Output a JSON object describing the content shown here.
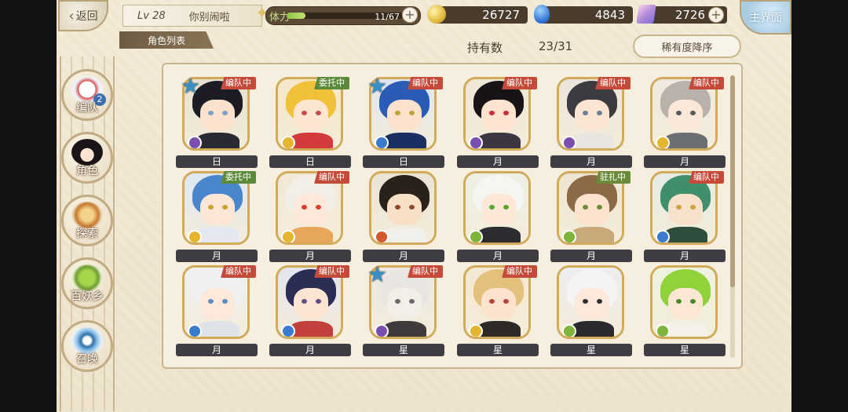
{
  "header": {
    "back_label": "返回",
    "level": "Lv 28",
    "player_name": "你别闹啦",
    "tab_label": "角色列表",
    "stamina_label": "体力",
    "stamina_value": "11/67",
    "stamina_fraction": 0.164,
    "gold": "26727",
    "blue_currency": "4843",
    "crystal": "2726",
    "main_label": "主界面"
  },
  "roster": {
    "count_label": "持有数",
    "count_value": "23/31",
    "sort_label": "稀有度降序"
  },
  "sidebar": {
    "items": [
      {
        "label": "编队",
        "badge": "2"
      },
      {
        "label": "角色"
      },
      {
        "label": "探索"
      },
      {
        "label": "百妖乡"
      },
      {
        "label": "召唤"
      }
    ]
  },
  "cards": [
    {
      "rank": "日",
      "tag": "编队中",
      "tag_type": "team",
      "star": true,
      "hair": "#1c1c24",
      "skin": "#fbe2cd",
      "eye": "#7aa2c8",
      "cloth": "#2a2a33",
      "elem": "#7a4fb0",
      "bg": "#e8e0cf"
    },
    {
      "rank": "日",
      "tag": "委托中",
      "tag_type": "commission",
      "star": false,
      "hair": "#f1c13a",
      "skin": "#fde6d1",
      "eye": "#c94c4c",
      "cloth": "#d33b3b",
      "elem": "#e6b52e",
      "bg": "#f5e7c8"
    },
    {
      "rank": "日",
      "tag": "编队中",
      "tag_type": "team",
      "star": true,
      "hair": "#2a5bb6",
      "skin": "#fbe2cd",
      "eye": "#c0a23a",
      "cloth": "#1b2f63",
      "elem": "#3a7bd0",
      "bg": "#dfe6f2"
    },
    {
      "rank": "月",
      "tag": "编队中",
      "tag_type": "team",
      "star": false,
      "hair": "#171317",
      "skin": "#fde3d0",
      "eye": "#c72f3a",
      "cloth": "#3b3640",
      "elem": "#7a4fb0",
      "bg": "#efe6d6"
    },
    {
      "rank": "月",
      "tag": "编队中",
      "tag_type": "team",
      "star": false,
      "hair": "#3b3b40",
      "skin": "#fbe4d2",
      "eye": "#6e7f95",
      "cloth": "#e9e6e2",
      "elem": "#7a4fb0",
      "bg": "#ebe5dc"
    },
    {
      "rank": "月",
      "tag": "编队中",
      "tag_type": "team",
      "star": false,
      "hair": "#b9b2ab",
      "skin": "#fbe7d8",
      "eye": "#5b5b5b",
      "cloth": "#6b6f72",
      "elem": "#e6b52e",
      "bg": "#efe9df"
    },
    {
      "rank": "月",
      "tag": "委托中",
      "tag_type": "commission",
      "star": false,
      "hair": "#4a86cc",
      "skin": "#fce6d6",
      "eye": "#c9a52a",
      "cloth": "#e4e9f1",
      "elem": "#e6b52e",
      "bg": "#dde8f3"
    },
    {
      "rank": "月",
      "tag": "编队中",
      "tag_type": "team",
      "star": false,
      "hair": "#f2eee8",
      "skin": "#fde8da",
      "eye": "#d6402d",
      "cloth": "#e7a65a",
      "elem": "#e6b52e",
      "bg": "#f3e8d8"
    },
    {
      "rank": "月",
      "tag": "",
      "tag_type": "",
      "star": false,
      "hair": "#2a211a",
      "skin": "#f8e0c7",
      "eye": "#8e4b2a",
      "cloth": "#f1efe9",
      "elem": "#d6562e",
      "bg": "#ebe3d4"
    },
    {
      "rank": "月",
      "tag": "",
      "tag_type": "",
      "star": false,
      "hair": "#f5f5f2",
      "skin": "#fde7d6",
      "eye": "#58a62f",
      "cloth": "#2d2d31",
      "elem": "#7cb53a",
      "bg": "#edf0e4"
    },
    {
      "rank": "月",
      "tag": "驻扎中",
      "tag_type": "station",
      "star": false,
      "hair": "#8b6a45",
      "skin": "#fbe3cd",
      "eye": "#6c8a37",
      "cloth": "#c9a97a",
      "elem": "#7cb53a",
      "bg": "#eee4d2"
    },
    {
      "rank": "月",
      "tag": "编队中",
      "tag_type": "team",
      "star": false,
      "hair": "#3f8f6a",
      "skin": "#f8e1ca",
      "eye": "#d0a23a",
      "cloth": "#2f4d3c",
      "elem": "#3a7bd0",
      "bg": "#e5ece3"
    },
    {
      "rank": "月",
      "tag": "编队中",
      "tag_type": "team",
      "star": false,
      "hair": "#eef0f2",
      "skin": "#fde8da",
      "eye": "#5a8fc2",
      "cloth": "#dfe3e7",
      "elem": "#3a7bd0",
      "bg": "#eef0f2"
    },
    {
      "rank": "月",
      "tag": "编队中",
      "tag_type": "team",
      "star": false,
      "hair": "#2a2e55",
      "skin": "#fbe4d2",
      "eye": "#5b4f86",
      "cloth": "#c3413d",
      "elem": "#3a7bd0",
      "bg": "#e3e4ee"
    },
    {
      "rank": "星",
      "tag": "编队中",
      "tag_type": "team",
      "star": true,
      "hair": "#e9e6e1",
      "skin": "#f2eee8",
      "eye": "#6a6a6a",
      "cloth": "#3e3b3a",
      "elem": "#7a4fb0",
      "bg": "#ece8e2"
    },
    {
      "rank": "星",
      "tag": "编队中",
      "tag_type": "team",
      "star": false,
      "hair": "#e4c07d",
      "skin": "#fbe3cd",
      "eye": "#b5463a",
      "cloth": "#2d2a28",
      "elem": "#e6b52e",
      "bg": "#f3e8d3"
    },
    {
      "rank": "星",
      "tag": "",
      "tag_type": "",
      "star": false,
      "hair": "#f3f4f6",
      "skin": "#fde8da",
      "eye": "#2f2f34",
      "cloth": "#2a2a2e",
      "elem": "#7cb53a",
      "bg": "#ecedf0"
    },
    {
      "rank": "星",
      "tag": "",
      "tag_type": "",
      "star": false,
      "hair": "#8fd23a",
      "skin": "#fbe7d3",
      "eye": "#4a8a2a",
      "cloth": "#f4f1e8",
      "elem": "#7cb53a",
      "bg": "#eef3e0"
    }
  ]
}
